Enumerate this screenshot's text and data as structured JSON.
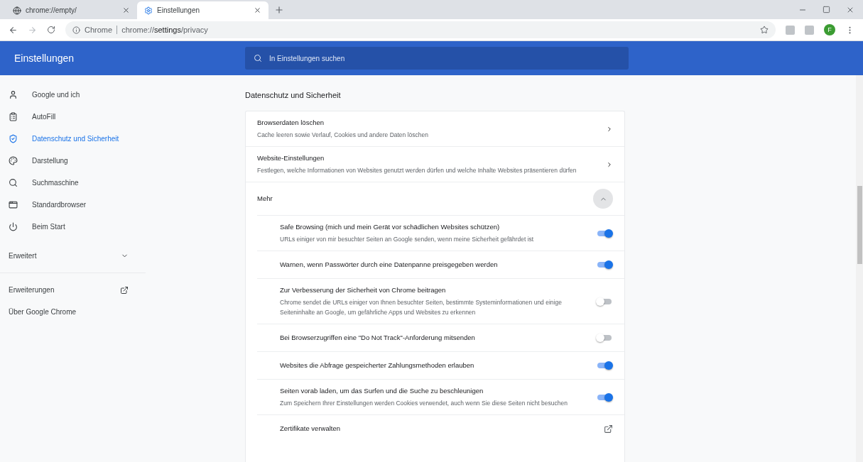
{
  "tabs": [
    {
      "label": "chrome://empty/",
      "selected": false
    },
    {
      "label": "Einstellungen",
      "selected": true
    }
  ],
  "address_bar": {
    "site": "Chrome",
    "url_prefix": "chrome://",
    "url_bold": "settings",
    "url_suffix": "/privacy"
  },
  "profile": {
    "initial": "F"
  },
  "header": {
    "title": "Einstellungen",
    "search_placeholder": "In Einstellungen suchen"
  },
  "sidebar": {
    "items": [
      {
        "label": "Google und ich",
        "selected": false
      },
      {
        "label": "AutoFill",
        "selected": false
      },
      {
        "label": "Datenschutz und Sicherheit",
        "selected": true
      },
      {
        "label": "Darstellung",
        "selected": false
      },
      {
        "label": "Suchmaschine",
        "selected": false
      },
      {
        "label": "Standardbrowser",
        "selected": false
      },
      {
        "label": "Beim Start",
        "selected": false
      }
    ],
    "advanced": {
      "label": "Erweitert",
      "expanded": false
    },
    "links": [
      {
        "label": "Erweiterungen",
        "external": true
      },
      {
        "label": "Über Google Chrome",
        "external": false
      }
    ]
  },
  "section": {
    "title": "Datenschutz und Sicherheit",
    "rows": [
      {
        "title": "Browserdaten löschen",
        "subtitle": "Cache leeren sowie Verlauf, Cookies und andere Daten löschen"
      },
      {
        "title": "Website-Einstellungen",
        "subtitle": "Festlegen, welche Informationen von Websites genutzt werden dürfen und welche Inhalte Websites präsentieren dürfen"
      }
    ],
    "more": {
      "label": "Mehr",
      "expanded": true,
      "items": [
        {
          "kind": "toggle",
          "title": "Safe Browsing (mich und mein Gerät vor schädlichen Websites schützen)",
          "subtitle": "URLs einiger von mir besuchter Seiten an Google senden, wenn meine Sicherheit gefährdet ist",
          "on": true
        },
        {
          "kind": "toggle",
          "title": "Warnen, wenn Passwörter durch eine Datenpanne preisgegeben werden",
          "on": true
        },
        {
          "kind": "toggle",
          "title": "Zur Verbesserung der Sicherheit von Chrome beitragen",
          "subtitle": "Chrome sendet die URLs einiger von Ihnen besuchter Seiten, bestimmte Systeminformationen und einige Seiteninhalte an Google, um gefährliche Apps und Websites zu erkennen",
          "on": false
        },
        {
          "kind": "toggle",
          "title": "Bei Browserzugriffen eine \"Do Not Track\"-Anforderung mitsenden",
          "on": false
        },
        {
          "kind": "toggle",
          "title": "Websites die Abfrage gespeicherter Zahlungsmethoden erlauben",
          "on": true
        },
        {
          "kind": "toggle",
          "title": "Seiten vorab laden, um das Surfen und die Suche zu beschleunigen",
          "subtitle": "Zum Speichern Ihrer Einstellungen werden Cookies verwendet, auch wenn Sie diese Seiten nicht besuchen",
          "on": true
        },
        {
          "kind": "external",
          "title": "Zertifikate verwalten"
        }
      ]
    }
  }
}
